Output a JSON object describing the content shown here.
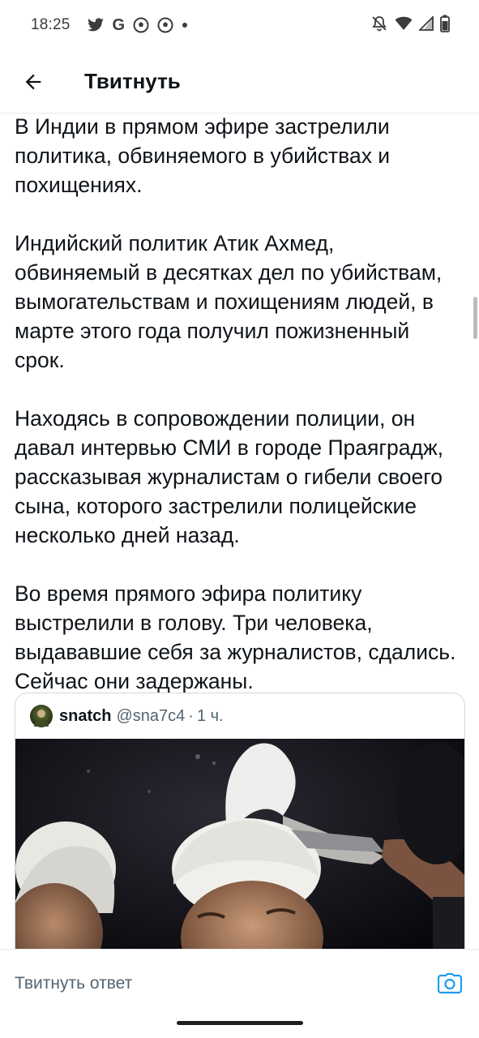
{
  "status_bar": {
    "time": "18:25",
    "left_icons": [
      "twitter-icon",
      "google-icon",
      "soccer-ball-icon",
      "soccer-ball-icon",
      "dot-icon"
    ],
    "right_icons": [
      "mute-icon",
      "wifi-icon",
      "signal-icon",
      "battery-icon"
    ]
  },
  "header": {
    "title": "Твитнуть"
  },
  "tweet": {
    "paragraphs": [
      "В Индии в прямом эфире застрелили политика, обвиняемого в убийствах и похищениях.",
      "Индийский политик Атик Ахмед, обвиняемый в десятках дел по убийствам, вымогательствам и похищениям людей, в марте этого года получил пожизненный срок.",
      "Находясь в сопровождении полиции, он давал интервью СМИ в городе Праяградж, рассказывая журналистам о гибели своего сына, которого застрелили полицейские несколько дней назад.",
      "Во время прямого эфира политику выстрелили в голову. Три человека, выдававшие себя за журналистов, сдались. Сейчас они задержаны."
    ]
  },
  "quote": {
    "name": "snatch",
    "handle": "@sna7c4",
    "separator": "·",
    "time": "1 ч."
  },
  "reply": {
    "placeholder": "Твитнуть ответ"
  },
  "colors": {
    "accent": "#1d9bf0",
    "text": "#0f1419",
    "secondary": "#536471",
    "border": "#cfd9de"
  }
}
